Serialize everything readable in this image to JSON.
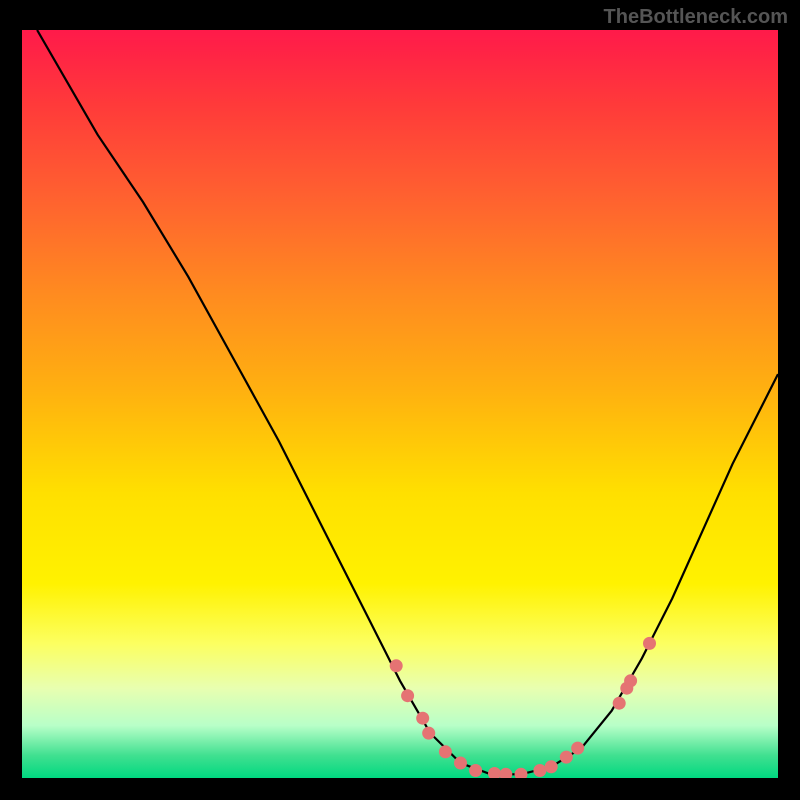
{
  "attribution": "TheBottleneck.com",
  "chart_data": {
    "type": "line",
    "title": "",
    "xlabel": "",
    "ylabel": "",
    "xlim": [
      0,
      100
    ],
    "ylim": [
      0,
      100
    ],
    "curve": [
      {
        "x": 2,
        "y": 100
      },
      {
        "x": 6,
        "y": 93
      },
      {
        "x": 10,
        "y": 86
      },
      {
        "x": 16,
        "y": 77
      },
      {
        "x": 22,
        "y": 67
      },
      {
        "x": 28,
        "y": 56
      },
      {
        "x": 34,
        "y": 45
      },
      {
        "x": 40,
        "y": 33
      },
      {
        "x": 46,
        "y": 21
      },
      {
        "x": 50,
        "y": 13
      },
      {
        "x": 54,
        "y": 6
      },
      {
        "x": 58,
        "y": 2
      },
      {
        "x": 62,
        "y": 0.5
      },
      {
        "x": 66,
        "y": 0.5
      },
      {
        "x": 70,
        "y": 1.5
      },
      {
        "x": 74,
        "y": 4
      },
      {
        "x": 78,
        "y": 9
      },
      {
        "x": 82,
        "y": 16
      },
      {
        "x": 86,
        "y": 24
      },
      {
        "x": 90,
        "y": 33
      },
      {
        "x": 94,
        "y": 42
      },
      {
        "x": 98,
        "y": 50
      },
      {
        "x": 100,
        "y": 54
      }
    ],
    "markers": [
      {
        "x": 49.5,
        "y": 15
      },
      {
        "x": 51,
        "y": 11
      },
      {
        "x": 53,
        "y": 8
      },
      {
        "x": 53.8,
        "y": 6
      },
      {
        "x": 56,
        "y": 3.5
      },
      {
        "x": 58,
        "y": 2
      },
      {
        "x": 60,
        "y": 1
      },
      {
        "x": 62.5,
        "y": 0.6
      },
      {
        "x": 64,
        "y": 0.5
      },
      {
        "x": 66,
        "y": 0.5
      },
      {
        "x": 68.5,
        "y": 1
      },
      {
        "x": 70,
        "y": 1.5
      },
      {
        "x": 72,
        "y": 2.8
      },
      {
        "x": 73.5,
        "y": 4
      },
      {
        "x": 79,
        "y": 10
      },
      {
        "x": 80,
        "y": 12
      },
      {
        "x": 80.5,
        "y": 13
      },
      {
        "x": 83,
        "y": 18
      }
    ],
    "marker_color": "#e57373",
    "curve_color": "#000000"
  }
}
